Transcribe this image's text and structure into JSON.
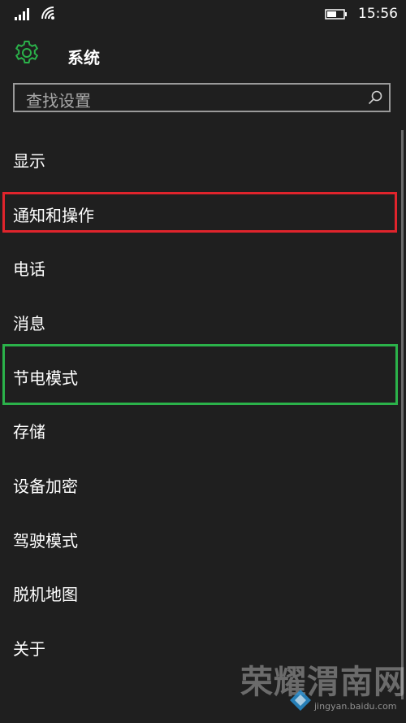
{
  "status_bar": {
    "time": "15:56"
  },
  "header": {
    "title": "系统"
  },
  "search": {
    "placeholder": "查找设置"
  },
  "menu": [
    {
      "label": "显示"
    },
    {
      "label": "通知和操作"
    },
    {
      "label": "电话"
    },
    {
      "label": "消息"
    },
    {
      "label": "节电模式"
    },
    {
      "label": "存储"
    },
    {
      "label": "设备加密"
    },
    {
      "label": "驾驶模式"
    },
    {
      "label": "脱机地图"
    },
    {
      "label": "关于"
    }
  ],
  "highlights": {
    "red_color": "#e0242c",
    "green_color": "#2bb24a"
  },
  "accent": "#2bb24a",
  "watermark": {
    "site": "荣耀渭南网",
    "url": "jingyan.baidu.com"
  }
}
